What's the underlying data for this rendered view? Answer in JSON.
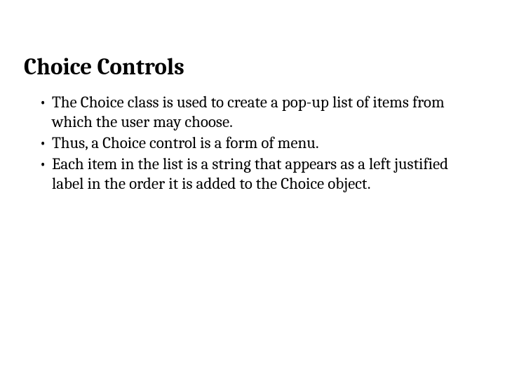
{
  "slide": {
    "title": "Choice Controls",
    "bullets": [
      "The Choice class is used to create a pop-up list of items from which the user may choose.",
      "Thus, a Choice control is a form of menu.",
      "Each item in the list is a string that appears as a left justified label in the order it is added to the Choice object."
    ]
  }
}
